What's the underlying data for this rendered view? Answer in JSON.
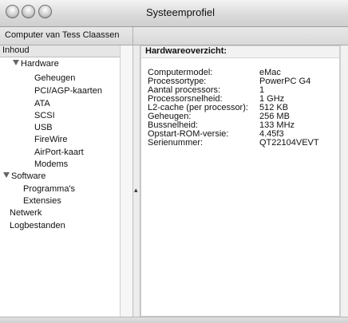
{
  "window": {
    "title": "Systeemprofiel"
  },
  "toolbar": {
    "computer_name": "Computer van Tess Claassen"
  },
  "sidebar": {
    "header": "Inhoud",
    "items": [
      {
        "label": "Hardware",
        "level": 0,
        "expanded": true,
        "selected": true
      },
      {
        "label": "Geheugen",
        "level": 1
      },
      {
        "label": "PCI/AGP-kaarten",
        "level": 1
      },
      {
        "label": "ATA",
        "level": 1
      },
      {
        "label": "SCSI",
        "level": 1
      },
      {
        "label": "USB",
        "level": 1
      },
      {
        "label": "FireWire",
        "level": 1
      },
      {
        "label": "AirPort-kaart",
        "level": 1
      },
      {
        "label": "Modems",
        "level": 1
      },
      {
        "label": "Software",
        "level": 0,
        "expanded": true
      },
      {
        "label": "Programma's",
        "level": 1
      },
      {
        "label": "Extensies",
        "level": 1
      },
      {
        "label": "Netwerk",
        "level": 0
      },
      {
        "label": "Logbestanden",
        "level": 0
      }
    ]
  },
  "main": {
    "header": "Hardwareoverzicht:",
    "rows": [
      {
        "label": "Computermodel:",
        "value": "eMac"
      },
      {
        "label": "Processortype:",
        "value": "PowerPC G4"
      },
      {
        "label": "Aantal processors:",
        "value": "1"
      },
      {
        "label": "Processorsnelheid:",
        "value": "1 GHz"
      },
      {
        "label": "L2-cache (per processor):",
        "value": "512 KB"
      },
      {
        "label": "Geheugen:",
        "value": "256 MB"
      },
      {
        "label": "Bussnelheid:",
        "value": "133 MHz"
      },
      {
        "label": "Opstart-ROM-versie:",
        "value": "4.45f3"
      },
      {
        "label": "Serienummer:",
        "value": "QT22104VEVT"
      }
    ]
  }
}
